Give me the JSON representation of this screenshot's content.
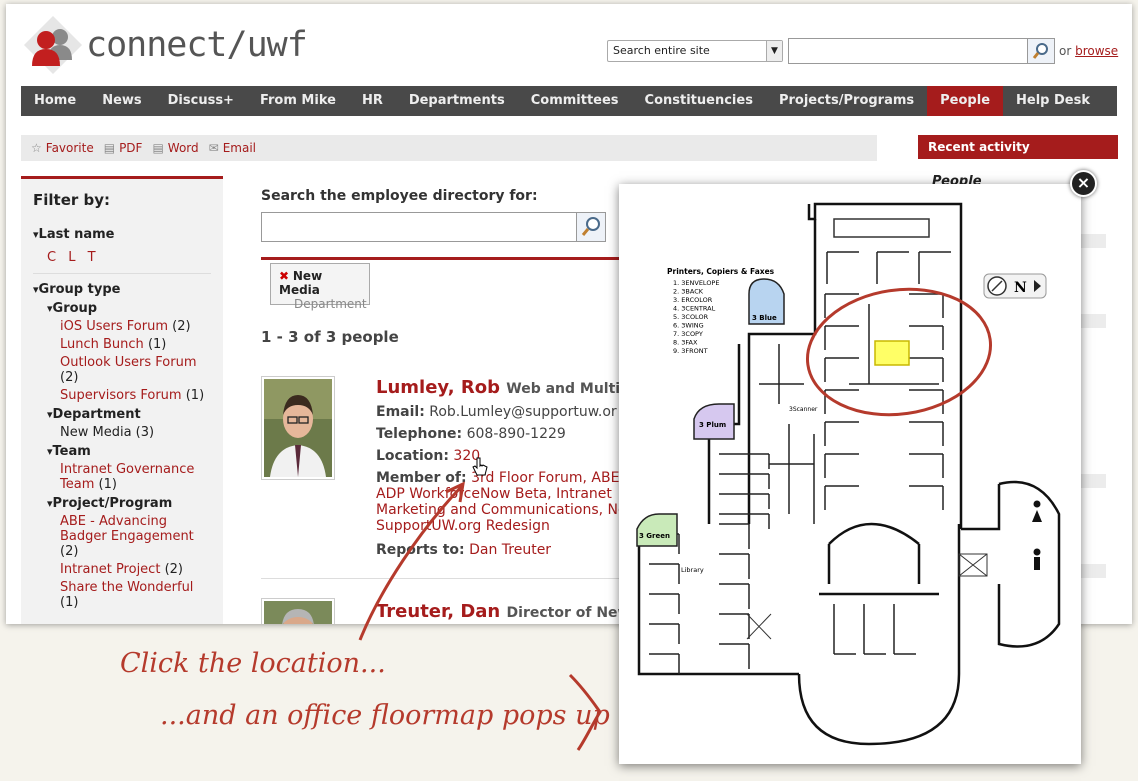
{
  "header": {
    "logo_text": "connect/uwf",
    "search_scope": "Search entire site",
    "search_value": "",
    "or_text": "or",
    "browse_label": "browse"
  },
  "nav": [
    "Home",
    "News",
    "Discuss+",
    "From Mike",
    "HR",
    "Departments",
    "Committees",
    "Constituencies",
    "Projects/Programs",
    "People",
    "Help Desk"
  ],
  "nav_active": "People",
  "toolbar": {
    "favorite": "Favorite",
    "pdf": "PDF",
    "word": "Word",
    "email": "Email"
  },
  "sidebar_right": {
    "title": "Recent activity",
    "subtitle": "People"
  },
  "filter": {
    "title": "Filter by:",
    "last_name_label": "Last name",
    "letters": "C  L  T",
    "group_type_label": "Group type",
    "group_label": "Group",
    "groups": [
      {
        "name": "iOS Users Forum",
        "count": "(2)"
      },
      {
        "name": "Lunch Bunch",
        "count": "(1)"
      },
      {
        "name": "Outlook Users Forum",
        "count": "(2)"
      },
      {
        "name": "Supervisors Forum",
        "count": "(1)"
      }
    ],
    "department_label": "Department",
    "department_value": "New Media (3)",
    "team_label": "Team",
    "team_value": "Intranet Governance Team",
    "team_count": "(1)",
    "project_label": "Project/Program",
    "projects": [
      {
        "name": "ABE - Advancing Badger Engagement",
        "count": "(2)"
      },
      {
        "name": "Intranet Project",
        "count": "(2)"
      },
      {
        "name": "Share the Wonderful",
        "count": "(1)"
      }
    ]
  },
  "main": {
    "search_label": "Search the employee directory for:",
    "search_value": "",
    "tag_title": "New Media",
    "tag_sub": "Department",
    "tag_x": "✖",
    "count_text": "1 - 3 of 3 people",
    "people": [
      {
        "name": "Lumley, Rob",
        "title": "Web and Multin",
        "email_label": "Email:",
        "email": "Rob.Lumley@supportuw.or",
        "phone_label": "Telephone:",
        "phone": "608-890-1229",
        "location_label": "Location:",
        "location": "320",
        "member_label": "Member of:",
        "member_line1": "3rd Floor Forum, ABE",
        "member_line2": "ADP WorkforceNow Beta, Intranet",
        "member_line3": "Marketing and Communications, Ne",
        "member_line4": "SupportUW.org Redesign",
        "reports_label": "Reports to:",
        "reports_to": "Dan Treuter"
      },
      {
        "name": "Treuter, Dan",
        "title": "Director of New"
      }
    ]
  },
  "annotations": {
    "line1": "Click the location...",
    "line2": "...and an office floormap pops up"
  },
  "floormap": {
    "legend_title": "Printers, Copiers & Faxes",
    "legend": [
      "1. 3ENVELOPE",
      "2. 3BACK",
      "3. ERCOLOR",
      "4. 3CENTRAL",
      "5. 3COLOR",
      "6. 3WING",
      "7. 3COPY",
      "8. 3FAX",
      "9. 3FRONT"
    ],
    "rooms": {
      "blue": "3 Blue",
      "plum": "3 Plum",
      "green": "3 Green",
      "library": "Library",
      "scanner": "3Scanner"
    },
    "compass_label": "N",
    "close_label": "×"
  },
  "colors": {
    "brand": "#a51c1c",
    "nav": "#494949",
    "annotation": "#b53a2c",
    "highlight": "#ffff66"
  }
}
